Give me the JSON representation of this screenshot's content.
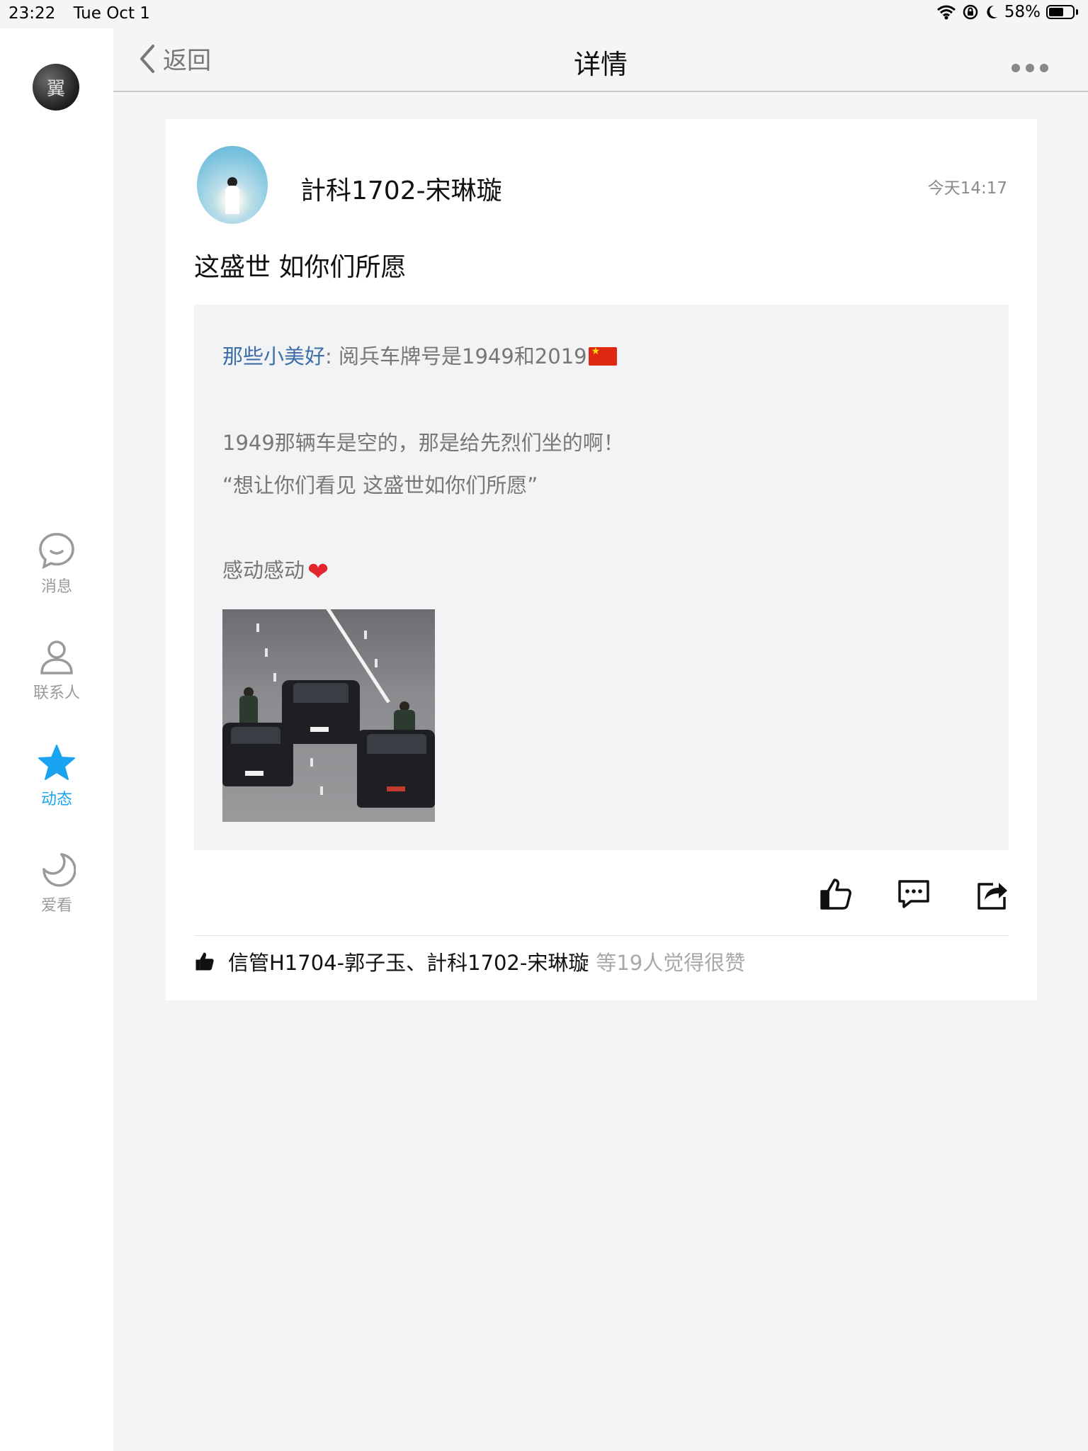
{
  "status_bar": {
    "time": "23:22",
    "date": "Tue Oct 1",
    "battery": "58%"
  },
  "sidebar": {
    "avatar_glyph": "翼",
    "items": [
      {
        "label": "消息",
        "icon": "chat-bubble-icon"
      },
      {
        "label": "联系人",
        "icon": "person-icon"
      },
      {
        "label": "动态",
        "icon": "star-icon",
        "active": true
      },
      {
        "label": "爱看",
        "icon": "crescent-icon"
      }
    ],
    "active_color": "#1aa3f0"
  },
  "header": {
    "back_label": "返回",
    "title": "详情"
  },
  "post": {
    "author": "計科1702-宋琳璇",
    "time": "今天14:17",
    "text": "这盛世 如你们所愿",
    "quote": {
      "author": "那些小美好",
      "line1": ": 阅兵车牌号是1949和2019",
      "line2": "1949那辆车是空的，那是给先烈们坐的啊！",
      "line3": "“想让你们看见  这盛世如你们所愿”",
      "line4": "感动感动"
    },
    "likes": {
      "names": "信管H1704-郭子玉、計科1702-宋琳璇",
      "suffix": "等19人觉得很赞"
    }
  }
}
